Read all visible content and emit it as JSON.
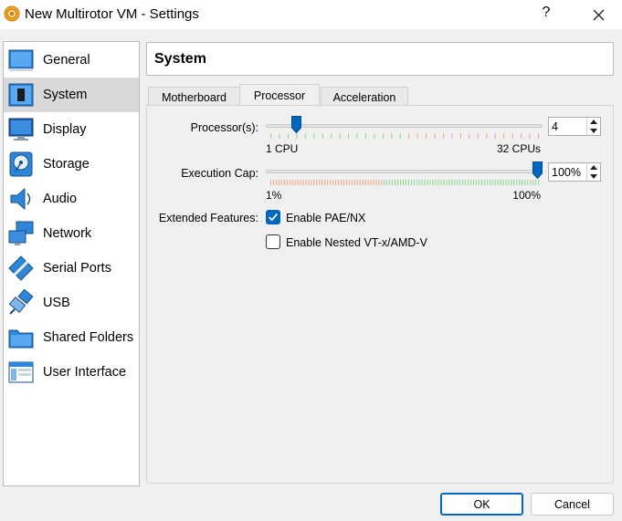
{
  "window": {
    "title": "New Multirotor VM - Settings",
    "help_label": "?",
    "icons": {
      "app": "virtualbox-gear-icon",
      "close": "close-icon"
    }
  },
  "sidebar": {
    "items": [
      {
        "label": "General",
        "icon": "general-icon",
        "selected": false
      },
      {
        "label": "System",
        "icon": "system-chip-icon",
        "selected": true
      },
      {
        "label": "Display",
        "icon": "display-monitor-icon",
        "selected": false
      },
      {
        "label": "Storage",
        "icon": "storage-disk-icon",
        "selected": false
      },
      {
        "label": "Audio",
        "icon": "audio-speaker-icon",
        "selected": false
      },
      {
        "label": "Network",
        "icon": "network-icon",
        "selected": false
      },
      {
        "label": "Serial Ports",
        "icon": "serial-port-icon",
        "selected": false
      },
      {
        "label": "USB",
        "icon": "usb-icon",
        "selected": false
      },
      {
        "label": "Shared Folders",
        "icon": "shared-folder-icon",
        "selected": false
      },
      {
        "label": "User Interface",
        "icon": "user-interface-icon",
        "selected": false
      }
    ]
  },
  "main": {
    "title": "System",
    "tabs": [
      {
        "label": "Motherboard",
        "active": false
      },
      {
        "label": "Processor",
        "active": true
      },
      {
        "label": "Acceleration",
        "active": false
      }
    ],
    "processor": {
      "label": "Processor(s):",
      "value": "4",
      "min_label": "1 CPU",
      "max_label": "32 CPUs",
      "min": 1,
      "max": 32,
      "current": 4
    },
    "execution_cap": {
      "label": "Execution Cap:",
      "value": "100%",
      "min_label": "1%",
      "max_label": "100%",
      "min": 1,
      "max": 100,
      "current": 100
    },
    "extended_features": {
      "label": "Extended Features:",
      "options": [
        {
          "label": "Enable PAE/NX",
          "checked": true
        },
        {
          "label": "Enable Nested VT-x/AMD-V",
          "checked": false
        }
      ]
    }
  },
  "footer": {
    "ok_label": "OK",
    "cancel_label": "Cancel"
  },
  "colors": {
    "accent": "#0067c0",
    "tick_good": "#8fd48f",
    "tick_warn": "#f2a38a",
    "selected_bg": "#d9d9d9"
  }
}
